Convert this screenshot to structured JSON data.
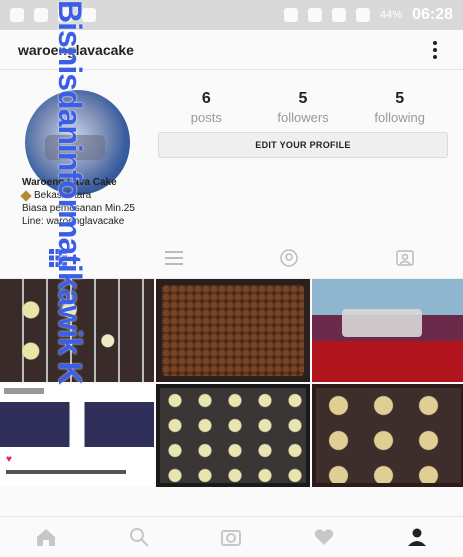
{
  "status_bar": {
    "time": "06:28",
    "battery": "44%"
  },
  "header": {
    "username": "waroenglavacake"
  },
  "profile": {
    "stats": [
      {
        "value": "6",
        "label": "posts"
      },
      {
        "value": "5",
        "label": "followers"
      },
      {
        "value": "5",
        "label": "following"
      }
    ],
    "edit_button": "EDIT YOUR PROFILE",
    "bio": {
      "name": "Waroeng Lava Cake",
      "location": "Bekasi Utara",
      "line1": "Biasa pemesanan Min.25",
      "line2": "Line: waroenglavacake"
    }
  },
  "tabs": [
    {
      "name": "grid-view",
      "icon": "grid-icon"
    },
    {
      "name": "list-view",
      "icon": "list-icon"
    },
    {
      "name": "location",
      "icon": "location-pin-icon"
    },
    {
      "name": "tagged",
      "icon": "tagged-photo-icon"
    }
  ],
  "grid": {
    "count": 6
  },
  "bottom_nav": [
    "home-icon",
    "search-icon",
    "camera-icon",
    "heart-icon",
    "profile-icon"
  ],
  "watermark": {
    "text": "Bisnisdaninformatikawik K"
  },
  "colors": {
    "background": "#fafafa",
    "status_bar": "#d9d9d9",
    "watermark": "#3b5ee6",
    "heart": "#e0245e"
  }
}
